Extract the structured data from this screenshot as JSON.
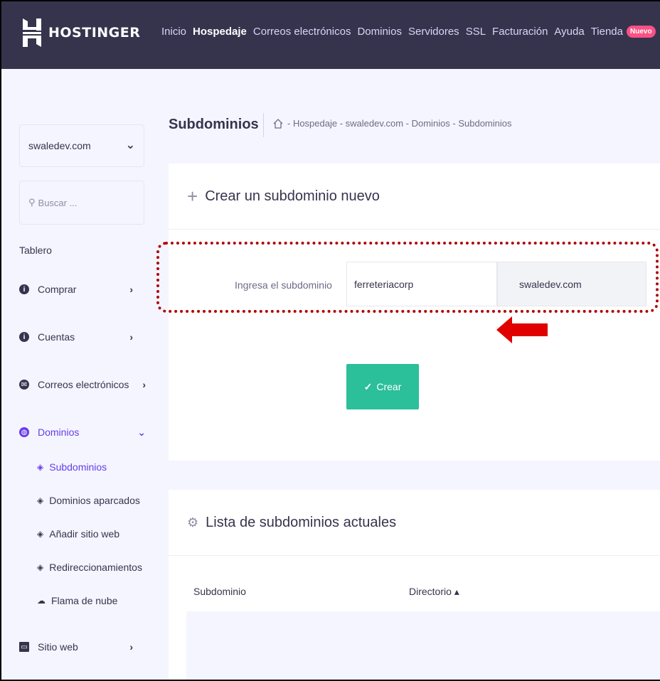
{
  "header": {
    "brand": "HOSTINGER",
    "nav": [
      "Inicio",
      "Hospedaje",
      "Correos electrónicos",
      "Dominios",
      "Servidores",
      "SSL",
      "Facturación",
      "Ayuda",
      "Tienda"
    ],
    "active_nav": "Hospedaje",
    "badge": "Nuevo"
  },
  "sidebar": {
    "domain": "swaledev.com",
    "search_placeholder": "Buscar ...",
    "tablero": "Tablero",
    "items": [
      {
        "label": "Comprar",
        "icon": "info-icon"
      },
      {
        "label": "Cuentas",
        "icon": "info-icon"
      },
      {
        "label": "Correos electrónicos",
        "icon": "mail-icon"
      },
      {
        "label": "Dominios",
        "icon": "globe-icon"
      }
    ],
    "sub_items": [
      "Subdominios",
      "Dominios aparcados",
      "Añadir sitio web",
      "Redireccionamientos",
      "Flama de nube"
    ],
    "last_item": "Sitio web"
  },
  "page": {
    "title": "Subdominios",
    "breadcrumb": "- Hospedaje - swaledev.com - Dominios - Subdominios"
  },
  "create_card": {
    "title": "Crear un subdominio nuevo",
    "label": "Ingresa el subdominio",
    "input_value": "ferreteriacorp",
    "suffix": "swaledev.com",
    "button": "Crear"
  },
  "list_card": {
    "title": "Lista de subdominios actuales",
    "columns": [
      "Subdominio",
      "Directorio ▴"
    ]
  },
  "colors": {
    "header_bg": "#36344d",
    "accent": "#673de6",
    "button": "#2bbf9a",
    "badge": "#fc5185",
    "highlight": "#b00000"
  }
}
